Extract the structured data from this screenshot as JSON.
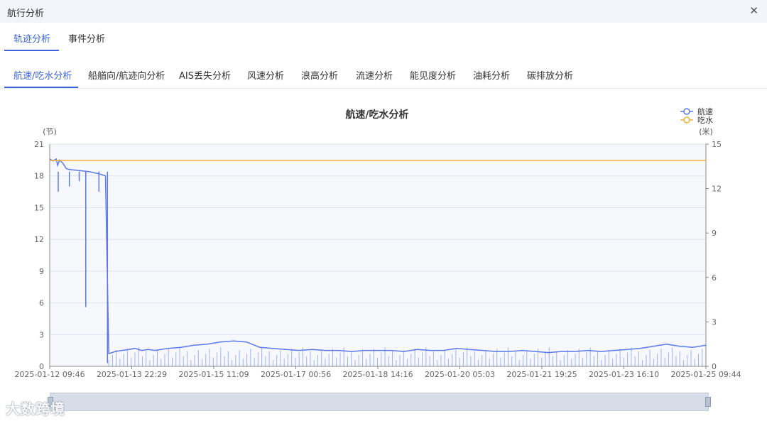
{
  "window": {
    "title": "航行分析",
    "close_icon": "close-icon"
  },
  "tabs": [
    {
      "label": "轨迹分析",
      "active": true
    },
    {
      "label": "事件分析",
      "active": false
    }
  ],
  "subtabs": [
    {
      "label": "航速/吃水分析",
      "active": true
    },
    {
      "label": "船艏向/航迹向分析",
      "active": false
    },
    {
      "label": "AIS丢失分析",
      "active": false
    },
    {
      "label": "风速分析",
      "active": false
    },
    {
      "label": "浪高分析",
      "active": false
    },
    {
      "label": "流速分析",
      "active": false
    },
    {
      "label": "能见度分析",
      "active": false
    },
    {
      "label": "油耗分析",
      "active": false
    },
    {
      "label": "碳排放分析",
      "active": false
    }
  ],
  "chart_data": {
    "type": "line",
    "title": "航速/吃水分析",
    "y_left": {
      "unit": "(节)",
      "min": 0,
      "max": 21,
      "ticks": [
        0,
        3,
        6,
        9,
        12,
        15,
        18,
        21
      ]
    },
    "y_right": {
      "unit": "(米)",
      "min": 0,
      "max": 15,
      "ticks": [
        0,
        3,
        6,
        9,
        12,
        15
      ]
    },
    "x_labels": [
      "2025-01-12 09:46",
      "2025-01-13 22:29",
      "2025-01-15 11:09",
      "2025-01-17 00:56",
      "2025-01-18 14:16",
      "2025-01-20 05:03",
      "2025-01-21 19:25",
      "2025-01-23 16:10",
      "2025-01-25 09:44"
    ],
    "legend": {
      "position": "top-right"
    },
    "colors": {
      "speed": "#5b79e8",
      "draft": "#f0b13a"
    },
    "series": [
      {
        "name": "航速",
        "axis": "left",
        "x": [
          0,
          0.005,
          0.01,
          0.012,
          0.015,
          0.02,
          0.025,
          0.03,
          0.045,
          0.06,
          0.075,
          0.085,
          0.09,
          0.1,
          0.11,
          0.12,
          0.13,
          0.14,
          0.15,
          0.16,
          0.18,
          0.2,
          0.22,
          0.24,
          0.26,
          0.28,
          0.3,
          0.32,
          0.34,
          0.36,
          0.38,
          0.4,
          0.42,
          0.44,
          0.46,
          0.48,
          0.5,
          0.52,
          0.54,
          0.56,
          0.58,
          0.6,
          0.62,
          0.64,
          0.66,
          0.68,
          0.7,
          0.72,
          0.74,
          0.76,
          0.78,
          0.8,
          0.82,
          0.84,
          0.86,
          0.88,
          0.9,
          0.92,
          0.94,
          0.96,
          0.98,
          1.0
        ],
        "y": [
          19.6,
          19.4,
          19.6,
          19.0,
          19.5,
          19.2,
          18.7,
          18.6,
          18.5,
          18.4,
          18.2,
          18.0,
          1.2,
          1.4,
          1.5,
          1.6,
          1.7,
          1.5,
          1.6,
          1.5,
          1.7,
          1.8,
          2.0,
          2.1,
          2.3,
          2.4,
          2.3,
          1.8,
          1.7,
          1.6,
          1.5,
          1.6,
          1.5,
          1.5,
          1.4,
          1.5,
          1.5,
          1.5,
          1.4,
          1.6,
          1.5,
          1.5,
          1.7,
          1.6,
          1.5,
          1.4,
          1.4,
          1.5,
          1.4,
          1.3,
          1.4,
          1.4,
          1.5,
          1.4,
          1.5,
          1.6,
          1.7,
          1.9,
          2.1,
          1.9,
          1.8,
          2.0
        ]
      },
      {
        "name": "吃水",
        "axis": "right",
        "x": [
          0,
          1.0
        ],
        "y": [
          13.9,
          13.9
        ]
      }
    ],
    "dips": [
      {
        "x": 0.013,
        "y": 16.5
      },
      {
        "x": 0.03,
        "y": 17.0
      },
      {
        "x": 0.045,
        "y": 17.5
      },
      {
        "x": 0.055,
        "y": 5.6
      },
      {
        "x": 0.075,
        "y": 16.5
      },
      {
        "x": 0.088,
        "y": 0.3
      }
    ]
  },
  "watermark": "大数跨境"
}
